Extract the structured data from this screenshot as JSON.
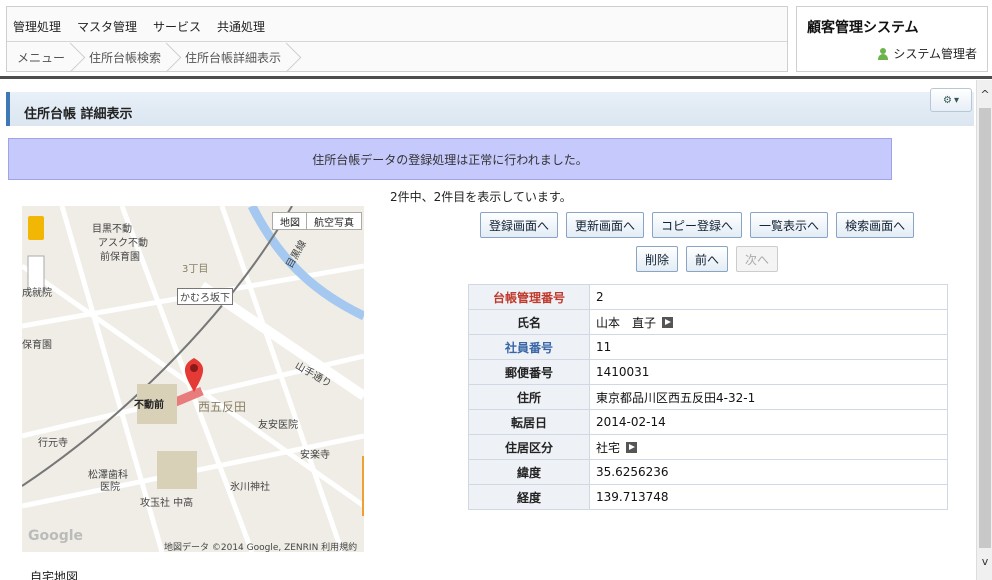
{
  "menu": [
    "管理処理",
    "マスタ管理",
    "サービス",
    "共通処理"
  ],
  "breadcrumb": [
    "メニュー",
    "住所台帳検索",
    "住所台帳詳細表示"
  ],
  "system": {
    "title": "顧客管理システム",
    "user": "システム管理者"
  },
  "panel": {
    "title": "住所台帳 詳細表示"
  },
  "message": "住所台帳データの登録処理は正常に行われました。",
  "count_text": "2件中、2件目を表示しています。",
  "buttons_row1": [
    "登録画面へ",
    "更新画面へ",
    "コピー登録へ",
    "一覧表示へ",
    "検索画面へ"
  ],
  "buttons_row2": {
    "delete": "削除",
    "prev": "前へ",
    "next": "次へ"
  },
  "map": {
    "caption": "自宅地図",
    "btn_map": "地図",
    "btn_aerial": "航空写真",
    "credit": "地図データ ©2014 Google, ZENRIN  利用規約",
    "labels": [
      "目黒不動",
      "アスク不動",
      "前保育園",
      "3丁目",
      "かむろ坂下",
      "目黒線",
      "山手通り",
      "不動前",
      "西五反田",
      "友安医院",
      "行元寺",
      "安楽寺",
      "松澤歯科",
      "医院",
      "氷川神社",
      "攻玉社 中高",
      "保育園",
      "成就院",
      "Google"
    ]
  },
  "details": [
    {
      "label": "台帳管理番号",
      "value": "2",
      "style": "red"
    },
    {
      "label": "氏名",
      "value": "山本　直子",
      "style": "",
      "icon": true
    },
    {
      "label": "社員番号",
      "value": "11",
      "style": "blue"
    },
    {
      "label": "郵便番号",
      "value": "1410031",
      "style": ""
    },
    {
      "label": "住所",
      "value": "東京都品川区西五反田4-32-1",
      "style": ""
    },
    {
      "label": "転居日",
      "value": "2014-02-14",
      "style": ""
    },
    {
      "label": "住居区分",
      "value": "社宅",
      "style": "",
      "icon": true
    },
    {
      "label": "緯度",
      "value": "35.6256236",
      "style": ""
    },
    {
      "label": "経度",
      "value": "139.713748",
      "style": ""
    }
  ]
}
